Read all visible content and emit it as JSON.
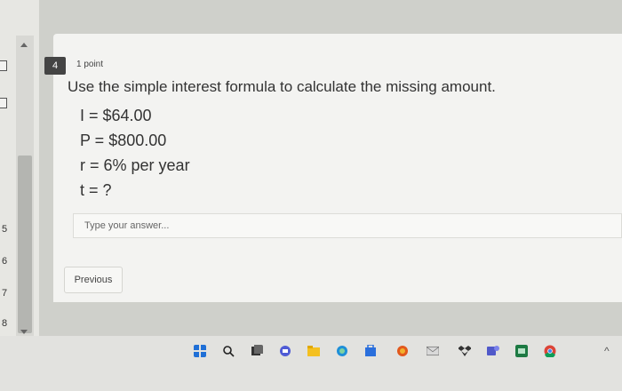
{
  "nav": {
    "numbers": [
      "5",
      "6",
      "7",
      "8"
    ]
  },
  "question": {
    "number": "4",
    "points": "1 point",
    "prompt": "Use the simple interest formula to calculate the missing amount.",
    "lines": [
      "I = $64.00",
      "P = $800.00",
      "r = 6% per year",
      "t = ?"
    ]
  },
  "answer": {
    "placeholder": "Type your answer..."
  },
  "buttons": {
    "previous": "Previous"
  },
  "taskbar": {
    "icons": [
      "windows-start-icon",
      "search-icon",
      "task-view-icon",
      "chat-icon",
      "file-explorer-icon",
      "edge-icon",
      "store-icon",
      "app-icon",
      "mail-icon",
      "dropbox-icon",
      "teams-icon",
      "excel-icon",
      "chrome-icon"
    ]
  }
}
